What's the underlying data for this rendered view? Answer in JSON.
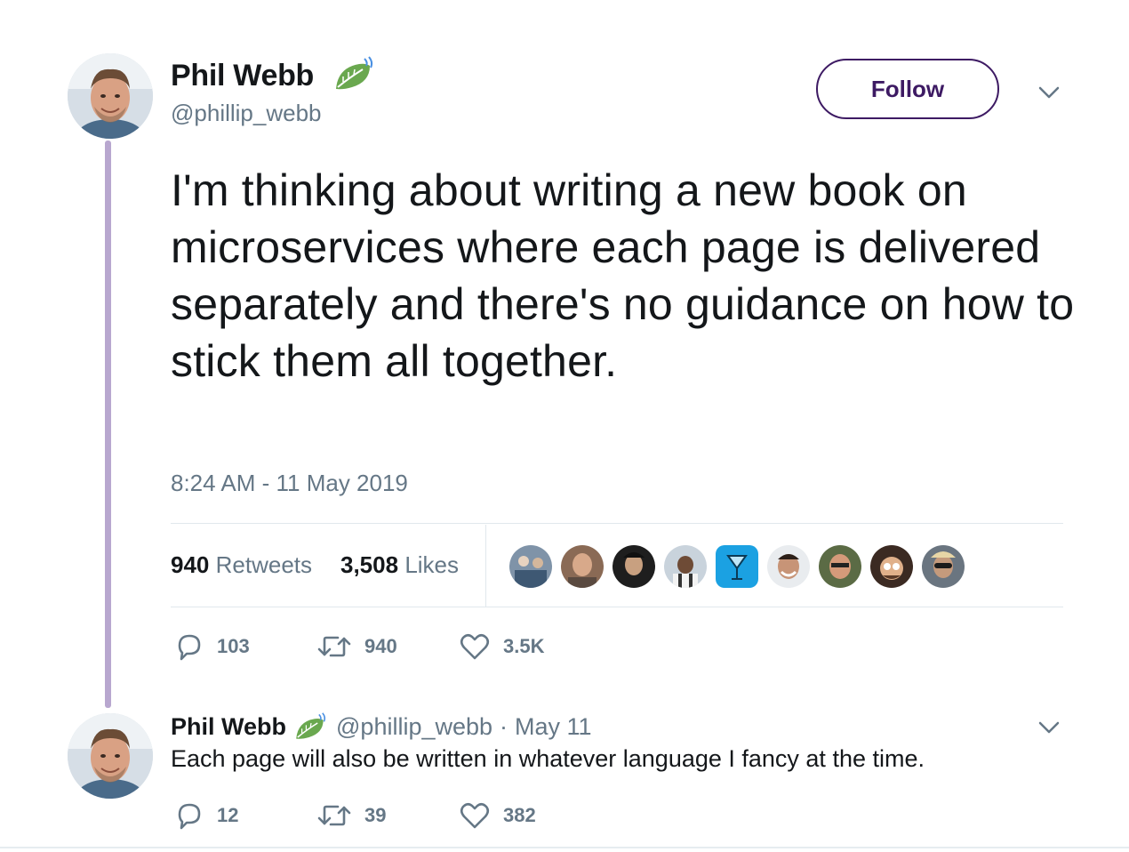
{
  "main_tweet": {
    "author_name": "Phil Webb",
    "author_handle": "@phillip_webb",
    "follow_label": "Follow",
    "text": "I'm thinking about writing a new book on microservices where each page is delivered separately and there's no guidance on how to stick them all together.",
    "timestamp": "8:24 AM - 11 May 2019",
    "retweets_count": "940",
    "retweets_label": "Retweets",
    "likes_count": "3,508",
    "likes_label": "Likes",
    "replies_action": "103",
    "retweets_action": "940",
    "likes_action": "3.5K",
    "icons": [
      "leaf-icon",
      "chevron-down-icon",
      "reply-icon",
      "retweet-icon",
      "heart-icon"
    ]
  },
  "likers": [
    "liker-1",
    "liker-2",
    "liker-3",
    "liker-4",
    "liker-5",
    "liker-6",
    "liker-7",
    "liker-8",
    "liker-9"
  ],
  "reply_tweet": {
    "author_name": "Phil Webb",
    "author_handle": "@phillip_webb",
    "separator": "·",
    "date": "May 11",
    "text": "Each page will also be written in whatever language I fancy at the time.",
    "replies_action": "12",
    "retweets_action": "39",
    "likes_action": "382"
  },
  "colors": {
    "follow_border": "#3d1a63",
    "thread_line": "#b8a7cf",
    "leaf": "#6aa84f",
    "muted": "#657786"
  }
}
